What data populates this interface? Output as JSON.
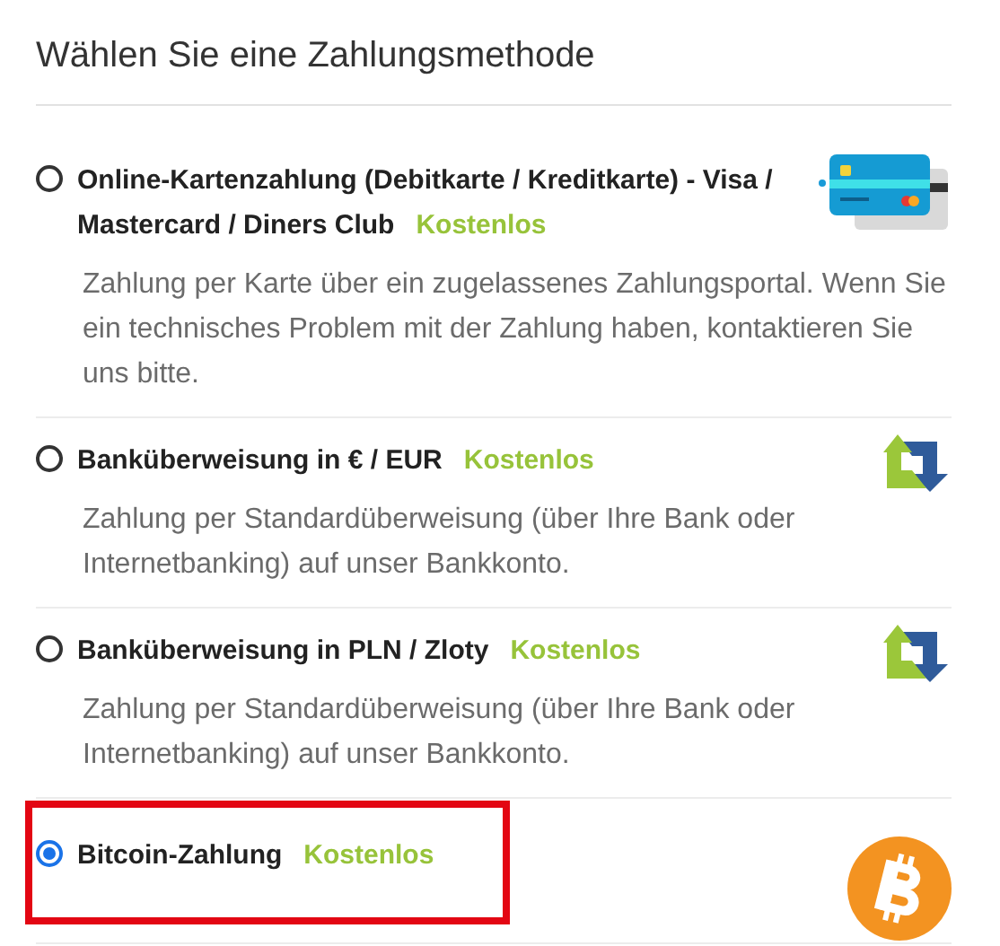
{
  "title": "Wählen Sie eine Zahlungsmethode",
  "methods": [
    {
      "name": "Online-Kartenzahlung (Debitkarte / Kreditkarte) - Visa / Mastercard / Diners Club",
      "badge": "Kostenlos",
      "description": "Zahlung per Karte über ein zugelassenes Zahlungsportal. Wenn Sie ein technisches Problem mit der Zahlung haben, kontaktieren Sie uns bitte.",
      "selected": false,
      "kind": "card"
    },
    {
      "name": "Banküberweisung in € / EUR",
      "badge": "Kostenlos",
      "description": "Zahlung per Standardüberweisung (über Ihre Bank oder Internetbanking) auf unser Bankkonto.",
      "selected": false,
      "kind": "transfer"
    },
    {
      "name": "Banküberweisung in PLN / Zloty",
      "badge": "Kostenlos",
      "description": "Zahlung per Standardüberweisung (über Ihre Bank oder Internetbanking) auf unser Bankkonto.",
      "selected": false,
      "kind": "transfer"
    },
    {
      "name": "Bitcoin-Zahlung",
      "badge": "Kostenlos",
      "selected": true,
      "kind": "bitcoin"
    }
  ]
}
